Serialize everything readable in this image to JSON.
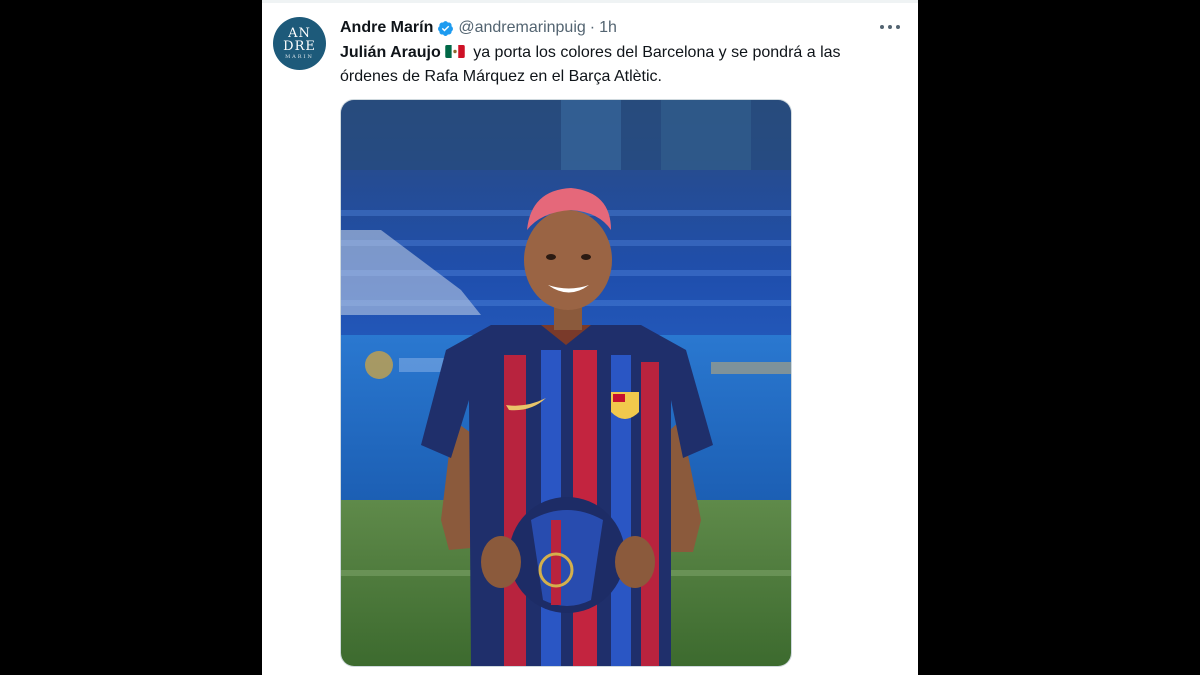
{
  "tweet": {
    "author": {
      "display_name": "Andre Marín",
      "handle": "@andremarinpuig",
      "avatar_text_line1": "AN",
      "avatar_text_line2": "DRE",
      "avatar_text_line3": "MARIN",
      "verified": true
    },
    "separator": "·",
    "time": "1h",
    "text": {
      "mention_name": "Julián Araujo",
      "flag_icon": "mexico-flag-icon",
      "body": "ya porta los colores del Barcelona y se pondrá a las órdenes de Rafa Márquez en el Barça Atlètic."
    },
    "more_icon": "more-horizontal-icon",
    "media": {
      "type": "photo",
      "subject": "player in FC Barcelona jersey holding ball"
    }
  },
  "colors": {
    "background": "#000000",
    "card": "#ffffff",
    "text_primary": "#0f1419",
    "text_secondary": "#536471",
    "verified_blue": "#1d9bf0",
    "avatar_bg": "#1d5a7a"
  }
}
